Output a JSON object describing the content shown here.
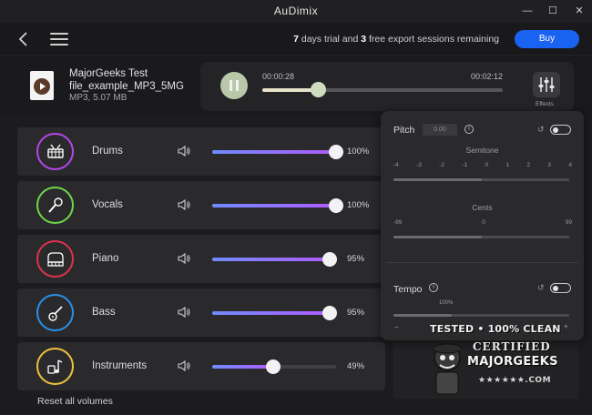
{
  "window": {
    "title": "AuDimix",
    "minimize": "—",
    "maximize": "☐",
    "close": "✕"
  },
  "nav": {
    "trial_days": "7",
    "trial_mid": " days trial and ",
    "trial_sessions": "3",
    "trial_end": " free export sessions remaining",
    "buy_label": "Buy"
  },
  "file": {
    "name": "MajorGeeks Test file_example_MP3_5MG",
    "meta": "MP3, 5.07 MB"
  },
  "player": {
    "time_current": "00:00:28",
    "time_total": "00:02:12",
    "progress": 0.23,
    "effects_label": "Effects"
  },
  "tracks": [
    {
      "name": "Drums",
      "volume": 100,
      "volume_label": "100%",
      "ring_color": "#b347e6",
      "icon": "drum-icon"
    },
    {
      "name": "Vocals",
      "volume": 100,
      "volume_label": "100%",
      "ring_color": "#6fd64a",
      "icon": "microphone-icon"
    },
    {
      "name": "Piano",
      "volume": 95,
      "volume_label": "95%",
      "ring_color": "#e0324f",
      "icon": "piano-icon"
    },
    {
      "name": "Bass",
      "volume": 95,
      "volume_label": "95%",
      "ring_color": "#2a8fe8",
      "icon": "guitar-icon"
    },
    {
      "name": "Instruments",
      "volume": 49,
      "volume_label": "49%",
      "ring_color": "#f0c040",
      "icon": "instruments-icon"
    }
  ],
  "reset_label": "Reset all volumes",
  "effects_panel": {
    "pitch_label": "Pitch",
    "pitch_value": "0.00",
    "semitone_label": "Semitone",
    "semitone_ticks": [
      "-4",
      "-3",
      "-2",
      "-1",
      "0",
      "1",
      "2",
      "3",
      "4"
    ],
    "semitone_value": 0,
    "cents_label": "Cents",
    "cents_ticks": [
      "-99",
      "0",
      "99"
    ],
    "cents_value": 0,
    "tempo_label": "Tempo",
    "tempo_value_label": "100%",
    "tempo_minus": "−",
    "tempo_plus": "+"
  },
  "badge": {
    "line1": "TESTED • 100% CLEAN",
    "line2": "CERTIFIED",
    "line3": "MAJORGEEKS",
    "line4": "★★★★★★.COM"
  },
  "colors": {
    "accent": "#1a63f0",
    "slider_start": "#6f8cff",
    "slider_end": "#b05bff"
  }
}
